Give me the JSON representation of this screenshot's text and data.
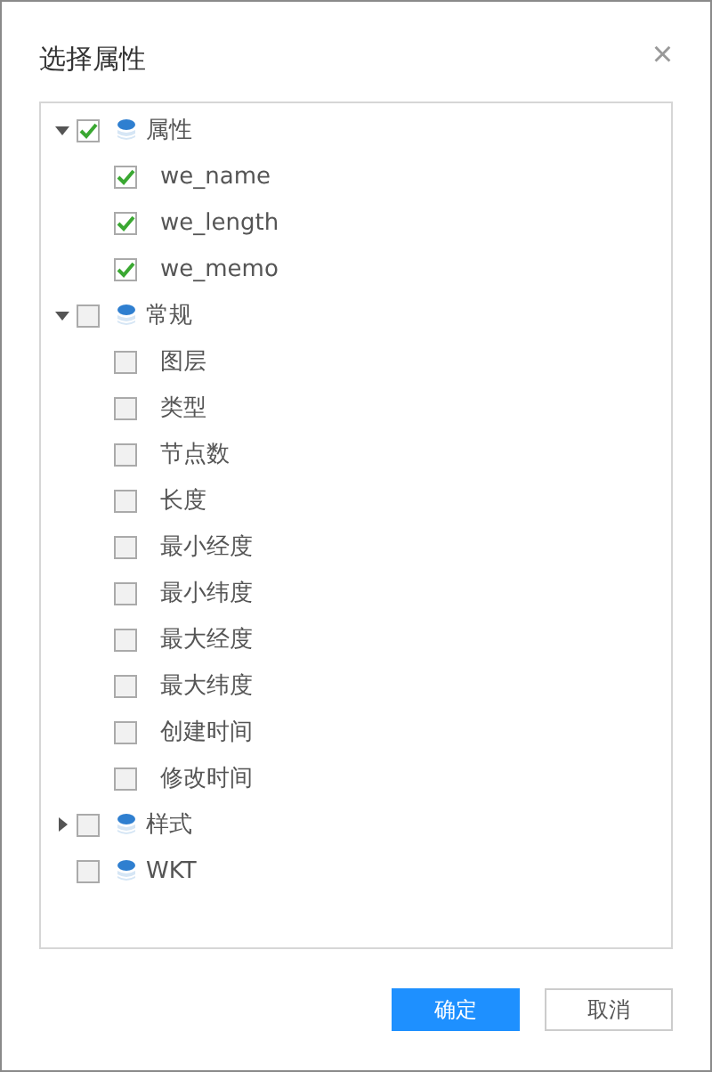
{
  "dialog": {
    "title": "选择属性",
    "close_icon": "×"
  },
  "tree": [
    {
      "kind": "group",
      "label": "属性",
      "expanded": true,
      "checked": true,
      "children": [
        {
          "label": "we_name",
          "checked": true
        },
        {
          "label": "we_length",
          "checked": true
        },
        {
          "label": "we_memo",
          "checked": true
        }
      ]
    },
    {
      "kind": "group",
      "label": "常规",
      "expanded": true,
      "checked": false,
      "children": [
        {
          "label": "图层",
          "checked": false
        },
        {
          "label": "类型",
          "checked": false
        },
        {
          "label": "节点数",
          "checked": false
        },
        {
          "label": "长度",
          "checked": false
        },
        {
          "label": "最小经度",
          "checked": false
        },
        {
          "label": "最小纬度",
          "checked": false
        },
        {
          "label": "最大经度",
          "checked": false
        },
        {
          "label": "最大纬度",
          "checked": false
        },
        {
          "label": "创建时间",
          "checked": false
        },
        {
          "label": "修改时间",
          "checked": false
        }
      ]
    },
    {
      "kind": "group",
      "label": "样式",
      "expanded": false,
      "checked": false
    },
    {
      "kind": "item",
      "label": "WKT",
      "checked": false
    }
  ],
  "buttons": [
    {
      "label": "确定",
      "kind": "primary"
    },
    {
      "label": "取消",
      "kind": "secondary"
    }
  ]
}
